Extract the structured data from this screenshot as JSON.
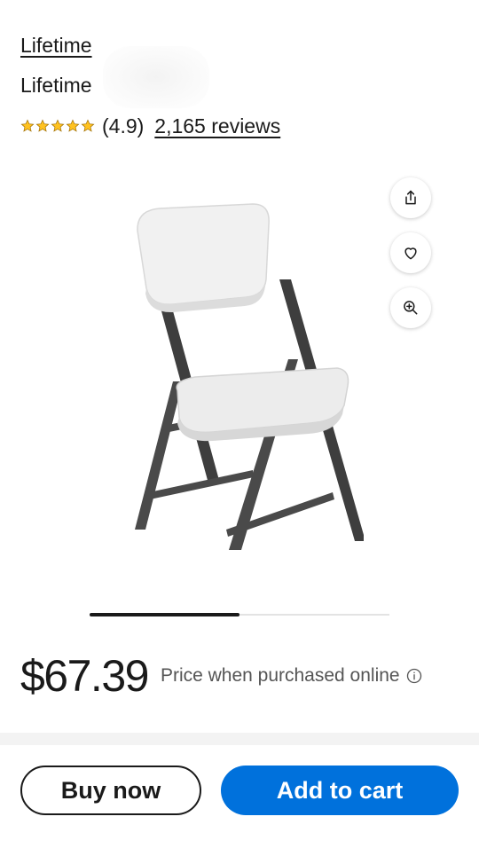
{
  "product": {
    "brand": "Lifetime",
    "title": "Lifetime",
    "rating_value": "(4.9)",
    "stars": 4.9,
    "reviews_label": "2,165 reviews"
  },
  "gallery": {
    "image_alt": "White folding chair with dark steel frame",
    "slides_viewed_fraction": 0.5
  },
  "actions_side": {
    "share_icon": "share-icon",
    "favorite_icon": "heart-icon",
    "zoom_icon": "zoom-in-icon"
  },
  "pricing": {
    "price": "$67.39",
    "note": "Price when purchased online"
  },
  "cta": {
    "buy_now": "Buy now",
    "add_to_cart": "Add to cart"
  },
  "colors": {
    "accent": "#0071dc",
    "star": "#ffc220",
    "text": "#1a1a1a"
  }
}
